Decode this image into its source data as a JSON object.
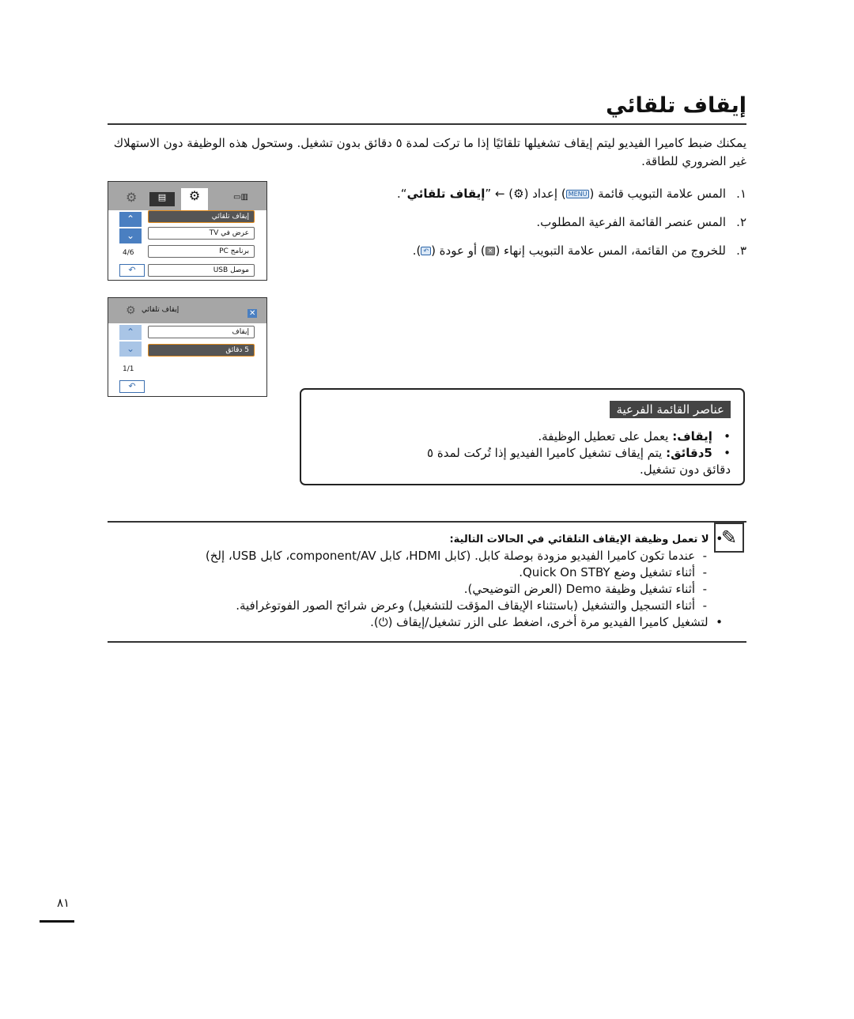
{
  "title": "إيقاف تلقائي",
  "intro": "يمكنك ضبط كاميرا الفيديو ليتم إيقاف تشغيلها تلقائيًا إذا ما تركت لمدة ٥ دقائق بدون تشغيل. وستحول هذه الوظيفة دون الاستهلاك غير الضروري للطاقة.",
  "steps": [
    {
      "num": "١.",
      "before": "المس علامة التبويب قائمة (",
      "icon1": "MENU",
      "mid": ") إعداد (",
      "icon2": "⚙",
      "after": ") ← ”",
      "bold": "إيقاف تلقائي",
      "end": "“."
    },
    {
      "num": "٢.",
      "text": "المس عنصر القائمة الفرعية المطلوب."
    },
    {
      "num": "٣.",
      "before": "للخروج من القائمة، المس علامة التبويب إنهاء (",
      "icon1": "✕",
      "mid": ") أو عودة (",
      "icon2": "↶",
      "end": ")."
    }
  ],
  "screen1": {
    "items": [
      "إيقاف تلقائي",
      "عرض في TV",
      "برنامج PC",
      "موصل USB"
    ],
    "counter": "4/6",
    "back": "↶"
  },
  "screen2": {
    "header": "إيقاف تلقائي",
    "items": [
      "إيقاف",
      "5 دقائق"
    ],
    "counter": "1/1",
    "back": "↶",
    "close": "✕"
  },
  "submenu": {
    "heading": "عناصر القائمة الفرعية",
    "items": [
      {
        "label": "إيقاف:",
        "text": " يعمل على تعطيل الوظيفة."
      },
      {
        "label": "5دقائق:",
        "text": " يتم إيقاف تشغيل كاميرا الفيديو إذا تُركت لمدة ٥ دقائق دون تشغيل."
      }
    ]
  },
  "note": {
    "heading": "لا تعمل وظيفة الإيقاف التلقائي في الحالات التالية:",
    "subitems": [
      "عندما تكون كاميرا الفيديو مزودة بوصلة كابل. (كابل HDMI، كابل component/AV، كابل USB، إلخ)",
      "أثناء تشغيل وضع Quick On STBY.",
      "أثناء تشغيل وظيفة Demo (العرض التوضيحي).",
      "أثناء التسجيل والتشغيل (باستثناء الإيقاف المؤقت للتشغيل) وعرض شرائح الصور الفوتوغرافية."
    ],
    "last": "لتشغيل كاميرا الفيديو مرة أخرى، اضغط على الزر تشغيل/إيقاف (⏻)."
  },
  "page_number": "٨١"
}
